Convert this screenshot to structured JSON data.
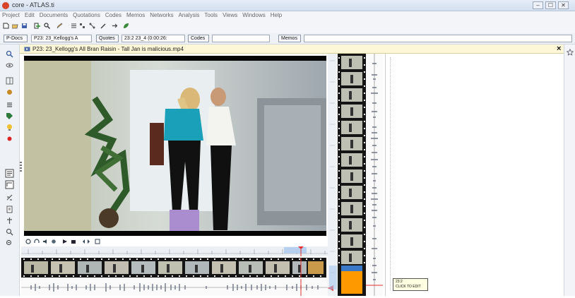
{
  "window": {
    "title": "core - ATLAS.ti",
    "buttons": [
      "–",
      "☐",
      "✕"
    ]
  },
  "menu": [
    "Project",
    "Edit",
    "Documents",
    "Quotations",
    "Codes",
    "Memos",
    "Networks",
    "Analysis",
    "Tools",
    "Views",
    "Windows",
    "Help"
  ],
  "docbar": {
    "p_docs_label": "P-Docs",
    "p_doc_value": "P23: 23_Kellogg's A",
    "quotes_label": "Quotes",
    "quote_value": "23:2 23_4 (0:00:26:",
    "codes_label": "Codes",
    "memos_label": "Memos"
  },
  "tab": {
    "title": "P23: 23_Kellogg's All Bran Raisin - Tall Jan is malicious.mp4",
    "close": "×"
  },
  "tooltip": {
    "line1": "23:2",
    "line2": "CLICK TO EDIT"
  },
  "colors": {
    "accent_orange": "#ff9900",
    "playhead_red": "#e53030",
    "selection_blue": "#3a78c8",
    "tab_yellow": "#fdf7d7"
  }
}
